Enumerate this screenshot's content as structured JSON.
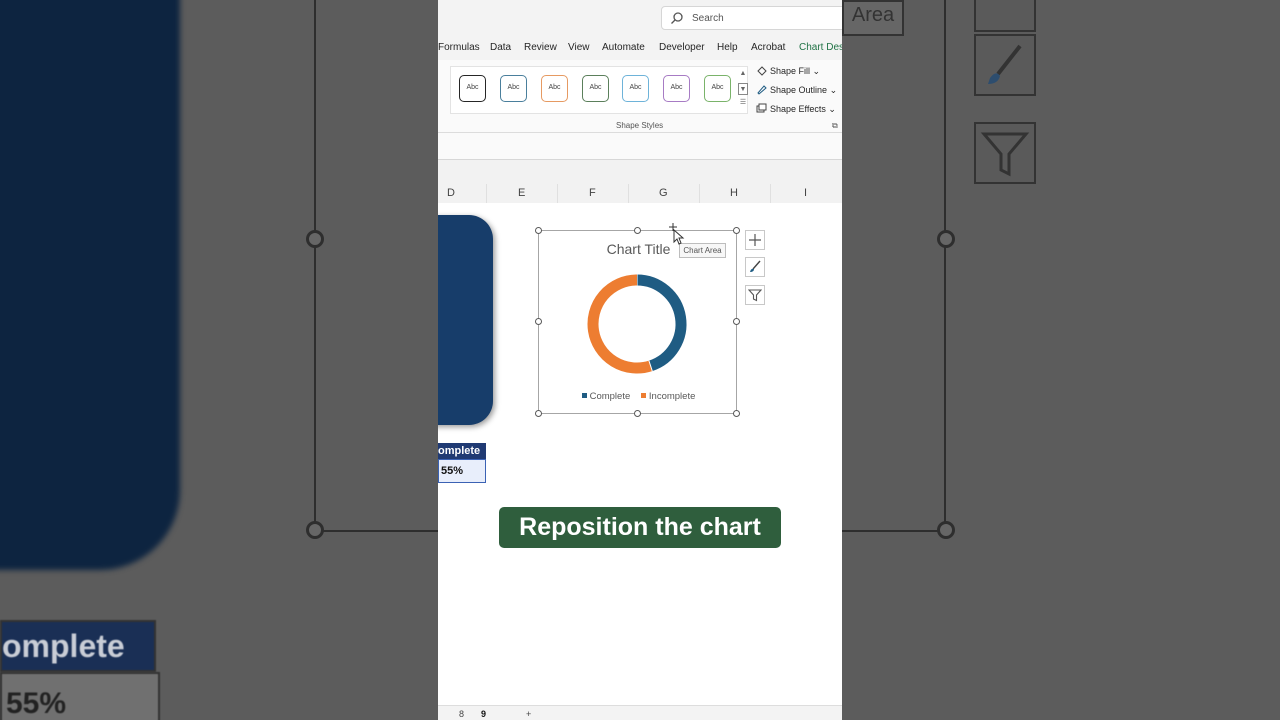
{
  "backdrop": {
    "label_text": "omplete",
    "value_text": "55%",
    "area_tag": "Area"
  },
  "titlebar": {
    "search_placeholder": "Search"
  },
  "menu": [
    "Formulas",
    "Data",
    "Review",
    "View",
    "Automate",
    "Developer",
    "Help",
    "Acrobat",
    "Chart Desi"
  ],
  "menu_active_index": 8,
  "ribbon": {
    "style_swatches": [
      {
        "label": "Abc",
        "color": "#262626"
      },
      {
        "label": "Abc",
        "color": "#4a7f9c"
      },
      {
        "label": "Abc",
        "color": "#e69a62"
      },
      {
        "label": "Abc",
        "color": "#5b7f5b"
      },
      {
        "label": "Abc",
        "color": "#6eb3d9"
      },
      {
        "label": "Abc",
        "color": "#a77bc4"
      },
      {
        "label": "Abc",
        "color": "#7ab36a"
      }
    ],
    "shape_fill": "Shape Fill",
    "shape_outline": "Shape Outline",
    "shape_effects": "Shape Effects",
    "group_label": "Shape Styles"
  },
  "columns": [
    "D",
    "E",
    "F",
    "G",
    "H",
    "I"
  ],
  "cells": {
    "header_label": "omplete",
    "value": "55%"
  },
  "chart_data": {
    "type": "pie",
    "title": "Chart Title",
    "donut": true,
    "categories": [
      "Complete",
      "Incomplete"
    ],
    "values": [
      45,
      55
    ],
    "colors": [
      "#1f5c83",
      "#ed7d31"
    ],
    "legend_position": "bottom"
  },
  "tooltip": "Chart Area",
  "caption": "Reposition the chart",
  "sheet_tabs": [
    "8",
    "9"
  ],
  "active_tab": "9",
  "add_sheet": "+"
}
